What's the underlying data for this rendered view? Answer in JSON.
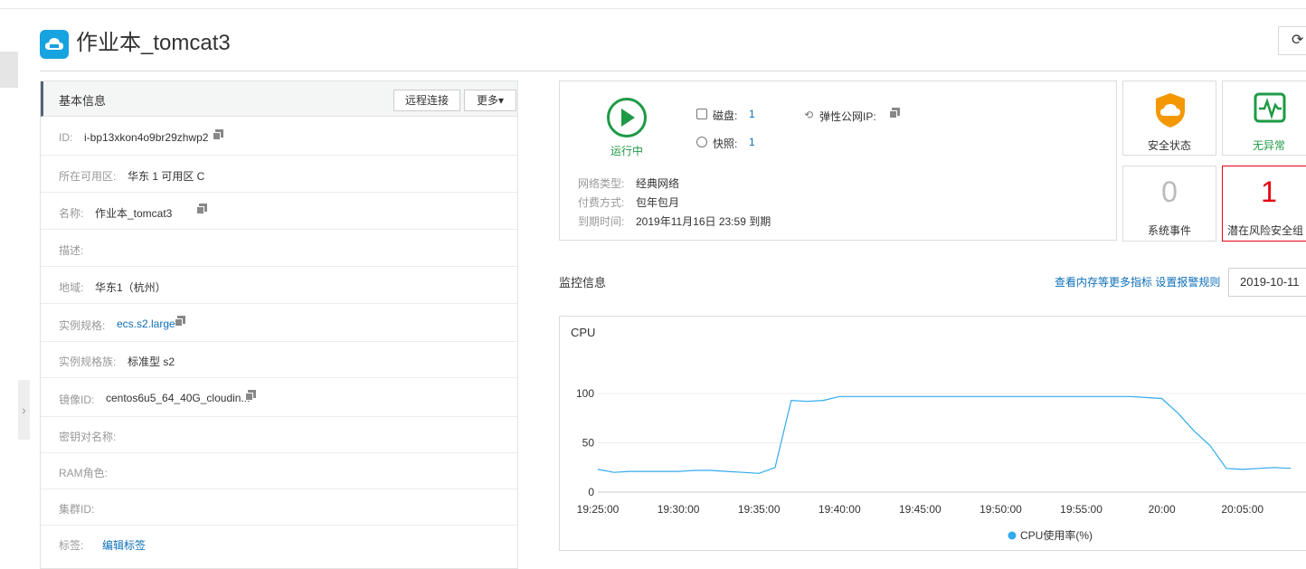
{
  "page": {
    "title": "作业本_tomcat3",
    "refresh_icon": "refresh-icon"
  },
  "basic": {
    "title": "基本信息",
    "remote_btn": "远程连接",
    "more_btn": "更多▾",
    "rows": [
      {
        "label": "ID:",
        "value": "i-bp13xkon4o9br29zhwp2"
      },
      {
        "label": "所在可用区:",
        "value": "华东 1 可用区 C"
      },
      {
        "label": "名称:",
        "value": "作业本_tomcat3"
      },
      {
        "label": "描述:",
        "value": ""
      },
      {
        "label": "地域:",
        "value": "华东1（杭州）"
      },
      {
        "label": "实例规格:",
        "value": "ecs.s2.large"
      },
      {
        "label": "实例规格族:",
        "value": "标准型 s2"
      },
      {
        "label": "镜像ID:",
        "value": "centos6u5_64_40G_cloudin..."
      },
      {
        "label": "密钥对名称:",
        "value": ""
      },
      {
        "label": "RAM角色:",
        "value": ""
      },
      {
        "label": "集群ID:",
        "value": ""
      },
      {
        "label": "标签:",
        "value": "编辑标签"
      }
    ]
  },
  "status": {
    "running": "运行中",
    "disk_label": "磁盘:",
    "disk_value": "1",
    "snapshot_label": "快照:",
    "snapshot_value": "1",
    "eip_label": "弹性公网IP:",
    "network_label": "网络类型:",
    "network_value": "经典网络",
    "billing_label": "付费方式:",
    "billing_value": "包年包月",
    "expire_label": "到期时间:",
    "expire_value": "2019年11月16日 23:59 到期"
  },
  "tiles": {
    "security_label": "安全状态",
    "normal_label": "无异常",
    "events_value": "0",
    "events_label": "系统事件",
    "risk_value": "1",
    "risk_label": "潜在风险安全组",
    "colors": {
      "security": "#f39800",
      "normal": "#1e9a46",
      "risk": "#e60012"
    }
  },
  "monitor": {
    "title": "监控信息",
    "links": "查看内存等更多指标 设置报警规则",
    "date": "2019-10-11"
  },
  "chart_data": {
    "type": "line",
    "title": "CPU",
    "x": [
      "19:25:00",
      "19:26:00",
      "19:27:00",
      "19:28:00",
      "19:29:00",
      "19:30:00",
      "19:31:00",
      "19:32:00",
      "19:33:00",
      "19:34:00",
      "19:35:00",
      "19:36:00",
      "19:37:00",
      "19:38:00",
      "19:39:00",
      "19:40:00",
      "19:42:00",
      "19:44:00",
      "19:46:00",
      "19:48:00",
      "19:50:00",
      "19:52:00",
      "19:54:00",
      "19:56:00",
      "19:58:00",
      "20:00:00",
      "20:01:00",
      "20:02:00",
      "20:03:00",
      "20:04:00",
      "20:05:00",
      "20:06:00",
      "20:07:00",
      "20:08:00"
    ],
    "xticks": [
      "19:25:00",
      "19:30:00",
      "19:35:00",
      "19:40:00",
      "19:45:00",
      "19:50:00",
      "19:55:00",
      "20:00",
      "20:05:00"
    ],
    "series": [
      {
        "name": "CPU使用率(%)",
        "color": "#33aaee",
        "values": [
          23,
          20,
          21,
          21,
          21,
          21,
          22,
          22,
          21,
          20,
          19,
          25,
          93,
          92,
          93,
          97,
          97,
          97,
          97,
          97,
          97,
          97,
          97,
          97,
          97,
          95,
          80,
          62,
          47,
          24,
          23,
          24,
          25,
          24,
          26
        ]
      }
    ],
    "ylim": [
      0,
      100
    ],
    "yticks": [
      0,
      50,
      100
    ]
  }
}
